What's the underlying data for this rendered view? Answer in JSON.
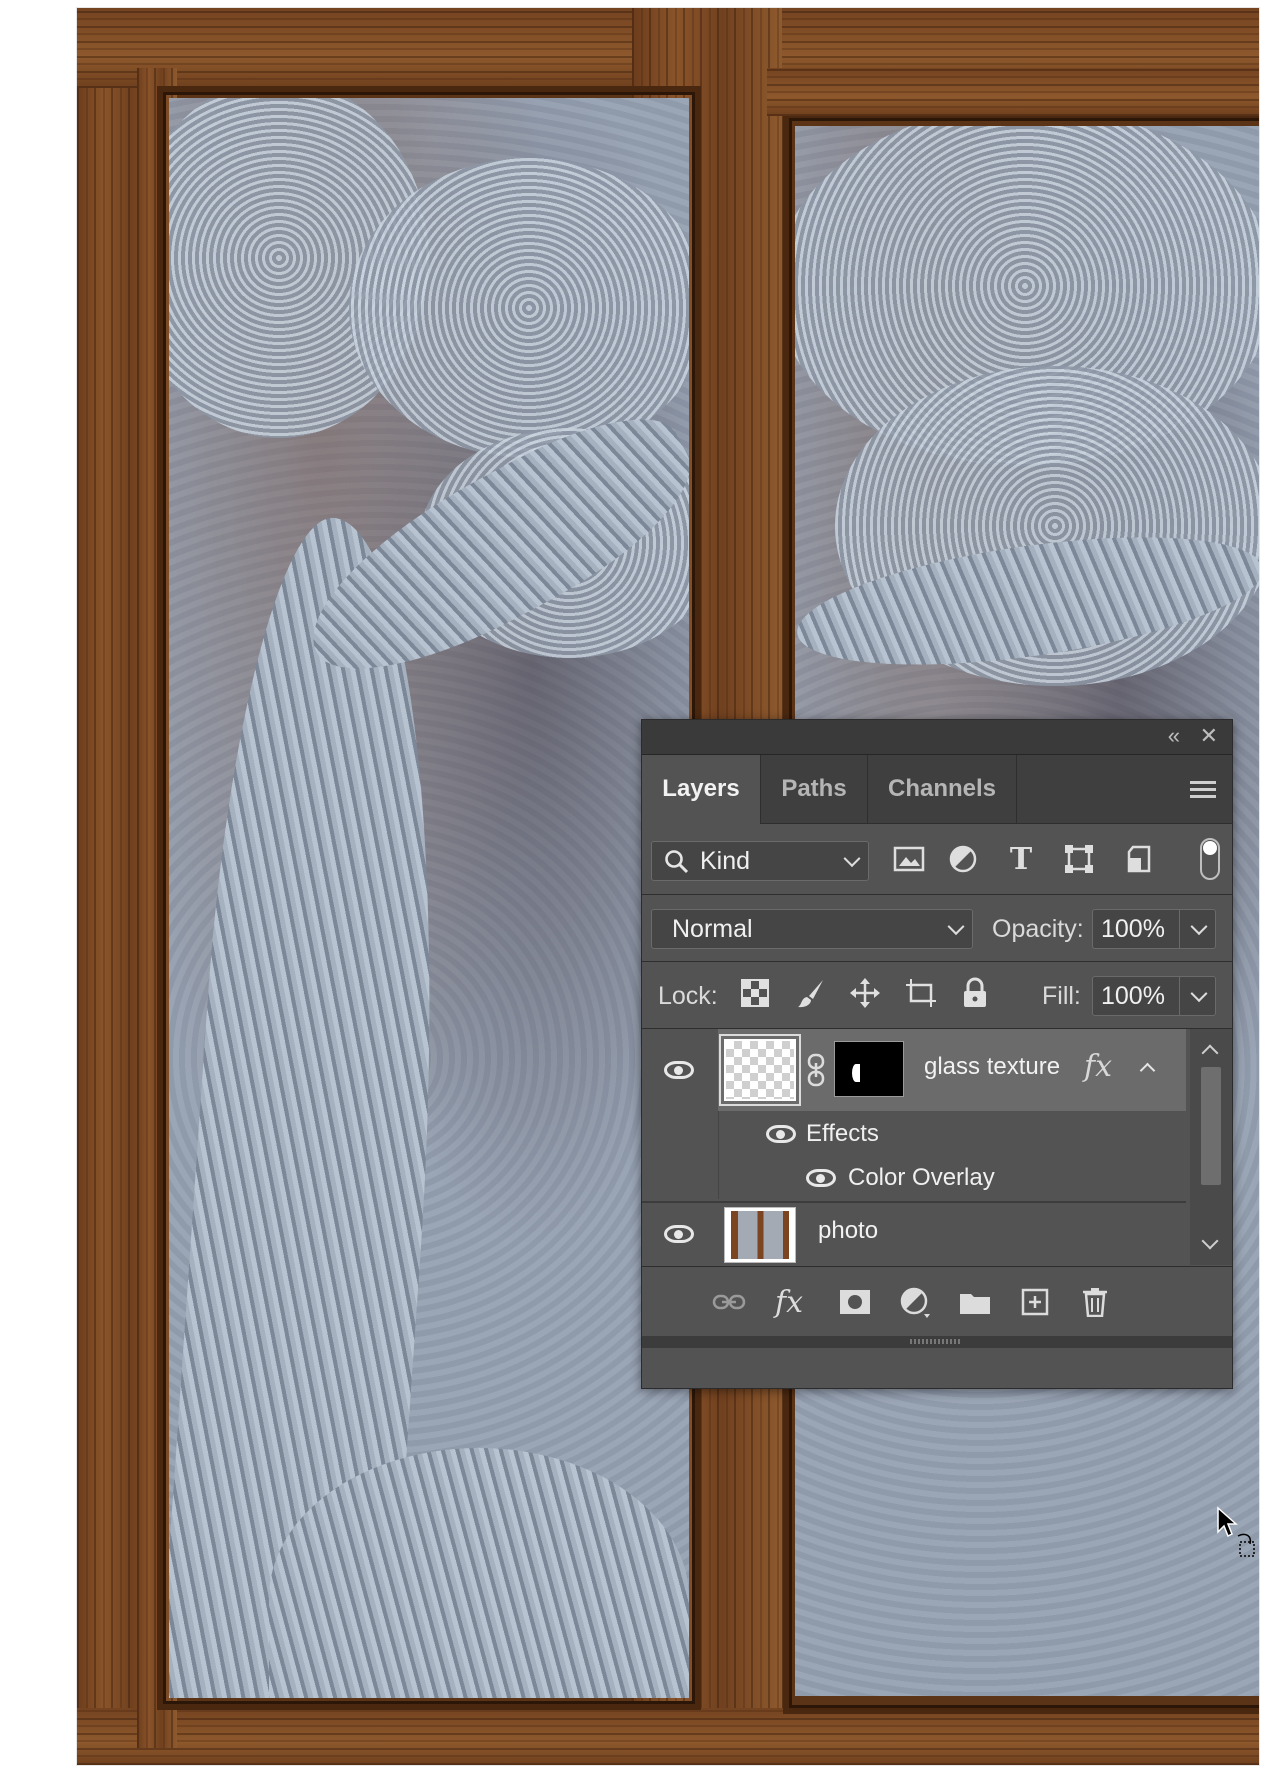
{
  "panel": {
    "tabs": [
      {
        "label": "Layers",
        "active": true
      },
      {
        "label": "Paths",
        "active": false
      },
      {
        "label": "Channels",
        "active": false
      }
    ],
    "filter": {
      "kind_label": "Kind"
    },
    "blend_mode": "Normal",
    "opacity_label": "Opacity:",
    "opacity_value": "100%",
    "lock_label": "Lock:",
    "fill_label": "Fill:",
    "fill_value": "100%",
    "layers": [
      {
        "name": "glass texture",
        "fx_badge": "fx",
        "visible": true,
        "effects_label": "Effects",
        "effect_items": [
          "Color Overlay"
        ]
      },
      {
        "name": "photo",
        "visible": true
      }
    ],
    "footer_fx_label": "fx"
  },
  "colors": {
    "panel_bg": "#535353",
    "title_bg": "#3a3a3a",
    "tabs_bg": "#3f3f3f",
    "selected_row_bg": "#6b6b6b",
    "text": "#e9e9e9"
  },
  "icons": {
    "filter": [
      "image-filter-icon",
      "adjustment-filter-icon",
      "type-filter-icon",
      "shape-filter-icon",
      "smart-object-filter-icon"
    ],
    "lock": [
      "lock-transparent-pixels-icon",
      "lock-image-pixels-icon",
      "lock-position-icon",
      "lock-artboard-icon",
      "lock-all-icon"
    ],
    "footer": [
      "link-layers-icon",
      "add-layer-style-icon",
      "add-mask-icon",
      "new-fill-adjustment-icon",
      "new-group-icon",
      "new-layer-icon",
      "delete-layer-icon"
    ]
  }
}
